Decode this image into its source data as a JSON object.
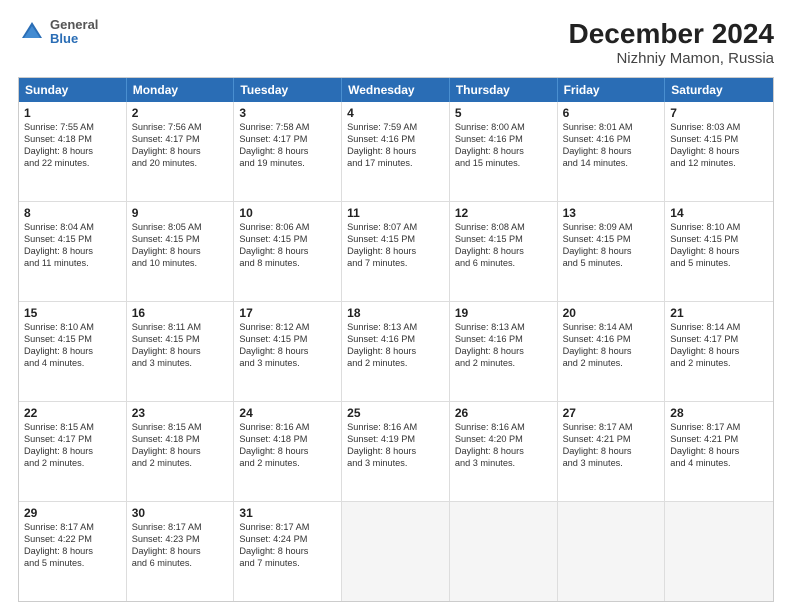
{
  "header": {
    "logo_general": "General",
    "logo_blue": "Blue",
    "title": "December 2024",
    "subtitle": "Nizhniy Mamon, Russia"
  },
  "calendar": {
    "days_of_week": [
      "Sunday",
      "Monday",
      "Tuesday",
      "Wednesday",
      "Thursday",
      "Friday",
      "Saturday"
    ],
    "rows": [
      [
        {
          "day": "1",
          "lines": [
            "Sunrise: 7:55 AM",
            "Sunset: 4:18 PM",
            "Daylight: 8 hours",
            "and 22 minutes."
          ]
        },
        {
          "day": "2",
          "lines": [
            "Sunrise: 7:56 AM",
            "Sunset: 4:17 PM",
            "Daylight: 8 hours",
            "and 20 minutes."
          ]
        },
        {
          "day": "3",
          "lines": [
            "Sunrise: 7:58 AM",
            "Sunset: 4:17 PM",
            "Daylight: 8 hours",
            "and 19 minutes."
          ]
        },
        {
          "day": "4",
          "lines": [
            "Sunrise: 7:59 AM",
            "Sunset: 4:16 PM",
            "Daylight: 8 hours",
            "and 17 minutes."
          ]
        },
        {
          "day": "5",
          "lines": [
            "Sunrise: 8:00 AM",
            "Sunset: 4:16 PM",
            "Daylight: 8 hours",
            "and 15 minutes."
          ]
        },
        {
          "day": "6",
          "lines": [
            "Sunrise: 8:01 AM",
            "Sunset: 4:16 PM",
            "Daylight: 8 hours",
            "and 14 minutes."
          ]
        },
        {
          "day": "7",
          "lines": [
            "Sunrise: 8:03 AM",
            "Sunset: 4:15 PM",
            "Daylight: 8 hours",
            "and 12 minutes."
          ]
        }
      ],
      [
        {
          "day": "8",
          "lines": [
            "Sunrise: 8:04 AM",
            "Sunset: 4:15 PM",
            "Daylight: 8 hours",
            "and 11 minutes."
          ]
        },
        {
          "day": "9",
          "lines": [
            "Sunrise: 8:05 AM",
            "Sunset: 4:15 PM",
            "Daylight: 8 hours",
            "and 10 minutes."
          ]
        },
        {
          "day": "10",
          "lines": [
            "Sunrise: 8:06 AM",
            "Sunset: 4:15 PM",
            "Daylight: 8 hours",
            "and 8 minutes."
          ]
        },
        {
          "day": "11",
          "lines": [
            "Sunrise: 8:07 AM",
            "Sunset: 4:15 PM",
            "Daylight: 8 hours",
            "and 7 minutes."
          ]
        },
        {
          "day": "12",
          "lines": [
            "Sunrise: 8:08 AM",
            "Sunset: 4:15 PM",
            "Daylight: 8 hours",
            "and 6 minutes."
          ]
        },
        {
          "day": "13",
          "lines": [
            "Sunrise: 8:09 AM",
            "Sunset: 4:15 PM",
            "Daylight: 8 hours",
            "and 5 minutes."
          ]
        },
        {
          "day": "14",
          "lines": [
            "Sunrise: 8:10 AM",
            "Sunset: 4:15 PM",
            "Daylight: 8 hours",
            "and 5 minutes."
          ]
        }
      ],
      [
        {
          "day": "15",
          "lines": [
            "Sunrise: 8:10 AM",
            "Sunset: 4:15 PM",
            "Daylight: 8 hours",
            "and 4 minutes."
          ]
        },
        {
          "day": "16",
          "lines": [
            "Sunrise: 8:11 AM",
            "Sunset: 4:15 PM",
            "Daylight: 8 hours",
            "and 3 minutes."
          ]
        },
        {
          "day": "17",
          "lines": [
            "Sunrise: 8:12 AM",
            "Sunset: 4:15 PM",
            "Daylight: 8 hours",
            "and 3 minutes."
          ]
        },
        {
          "day": "18",
          "lines": [
            "Sunrise: 8:13 AM",
            "Sunset: 4:16 PM",
            "Daylight: 8 hours",
            "and 2 minutes."
          ]
        },
        {
          "day": "19",
          "lines": [
            "Sunrise: 8:13 AM",
            "Sunset: 4:16 PM",
            "Daylight: 8 hours",
            "and 2 minutes."
          ]
        },
        {
          "day": "20",
          "lines": [
            "Sunrise: 8:14 AM",
            "Sunset: 4:16 PM",
            "Daylight: 8 hours",
            "and 2 minutes."
          ]
        },
        {
          "day": "21",
          "lines": [
            "Sunrise: 8:14 AM",
            "Sunset: 4:17 PM",
            "Daylight: 8 hours",
            "and 2 minutes."
          ]
        }
      ],
      [
        {
          "day": "22",
          "lines": [
            "Sunrise: 8:15 AM",
            "Sunset: 4:17 PM",
            "Daylight: 8 hours",
            "and 2 minutes."
          ]
        },
        {
          "day": "23",
          "lines": [
            "Sunrise: 8:15 AM",
            "Sunset: 4:18 PM",
            "Daylight: 8 hours",
            "and 2 minutes."
          ]
        },
        {
          "day": "24",
          "lines": [
            "Sunrise: 8:16 AM",
            "Sunset: 4:18 PM",
            "Daylight: 8 hours",
            "and 2 minutes."
          ]
        },
        {
          "day": "25",
          "lines": [
            "Sunrise: 8:16 AM",
            "Sunset: 4:19 PM",
            "Daylight: 8 hours",
            "and 3 minutes."
          ]
        },
        {
          "day": "26",
          "lines": [
            "Sunrise: 8:16 AM",
            "Sunset: 4:20 PM",
            "Daylight: 8 hours",
            "and 3 minutes."
          ]
        },
        {
          "day": "27",
          "lines": [
            "Sunrise: 8:17 AM",
            "Sunset: 4:21 PM",
            "Daylight: 8 hours",
            "and 3 minutes."
          ]
        },
        {
          "day": "28",
          "lines": [
            "Sunrise: 8:17 AM",
            "Sunset: 4:21 PM",
            "Daylight: 8 hours",
            "and 4 minutes."
          ]
        }
      ],
      [
        {
          "day": "29",
          "lines": [
            "Sunrise: 8:17 AM",
            "Sunset: 4:22 PM",
            "Daylight: 8 hours",
            "and 5 minutes."
          ]
        },
        {
          "day": "30",
          "lines": [
            "Sunrise: 8:17 AM",
            "Sunset: 4:23 PM",
            "Daylight: 8 hours",
            "and 6 minutes."
          ]
        },
        {
          "day": "31",
          "lines": [
            "Sunrise: 8:17 AM",
            "Sunset: 4:24 PM",
            "Daylight: 8 hours",
            "and 7 minutes."
          ]
        },
        null,
        null,
        null,
        null
      ]
    ]
  }
}
